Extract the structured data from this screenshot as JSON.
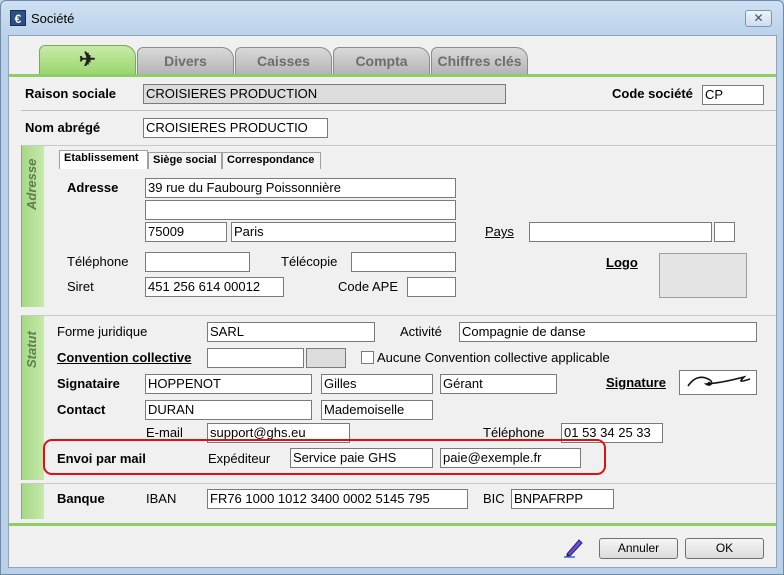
{
  "window": {
    "title": "Société"
  },
  "tabs": [
    "Divers",
    "Caisses",
    "Compta",
    "Chiffres clés"
  ],
  "header": {
    "raison_label": "Raison sociale",
    "raison_value": "CROISIERES PRODUCTION",
    "code_label": "Code société",
    "code_value": "CP",
    "nom_label": "Nom abrégé",
    "nom_value": "CROISIERES PRODUCTIO"
  },
  "adresse": {
    "band": "Adresse",
    "subtabs": [
      "Etablissement",
      "Siège social",
      "Correspondance"
    ],
    "adresse_label": "Adresse",
    "line1": "39 rue du Faubourg Poissonnière",
    "line2": "",
    "cp": "75009",
    "ville": "Paris",
    "pays_label": "Pays",
    "pays_value": "",
    "pays_code": "",
    "tel_label": "Téléphone",
    "tel_value": "",
    "fax_label": "Télécopie",
    "fax_value": "",
    "logo_label": "Logo",
    "siret_label": "Siret",
    "siret_value": "451 256 614 00012",
    "ape_label": "Code APE",
    "ape_value": ""
  },
  "statut": {
    "band": "Statut",
    "forme_label": "Forme juridique",
    "forme_value": "SARL",
    "activite_label": "Activité",
    "activite_value": "Compagnie de danse",
    "convention_label": "Convention collective",
    "convention_value": "",
    "convention_code": "",
    "aucune_label": "Aucune Convention collective applicable",
    "signataire_label": "Signataire",
    "signataire_nom": "HOPPENOT",
    "signataire_prenom": "Gilles",
    "signataire_fonction": "Gérant",
    "signature_label": "Signature",
    "contact_label": "Contact",
    "contact_nom": "DURAN",
    "contact_civilite": "Mademoiselle",
    "email_label": "E-mail",
    "email_value": "support@ghs.eu",
    "tel_label": "Téléphone",
    "tel_value": "01 53 34 25 33",
    "envoi_label": "Envoi par mail",
    "expediteur_label": "Expéditeur",
    "expediteur_nom": "Service paie GHS",
    "expediteur_email": "paie@exemple.fr"
  },
  "banque": {
    "label": "Banque",
    "iban_label": "IBAN",
    "iban_value": "FR76 1000 1012 3400 0002 5145 795",
    "bic_label": "BIC",
    "bic_value": "BNPAFRPP"
  },
  "footer": {
    "cancel": "Annuler",
    "ok": "OK"
  },
  "icons": {
    "app": "app-icon",
    "close": "close-icon",
    "plane": "airplane-icon",
    "edit": "pen-icon"
  },
  "colors": {
    "accent_green": "#9bd46d",
    "highlight_red": "#e01010"
  }
}
